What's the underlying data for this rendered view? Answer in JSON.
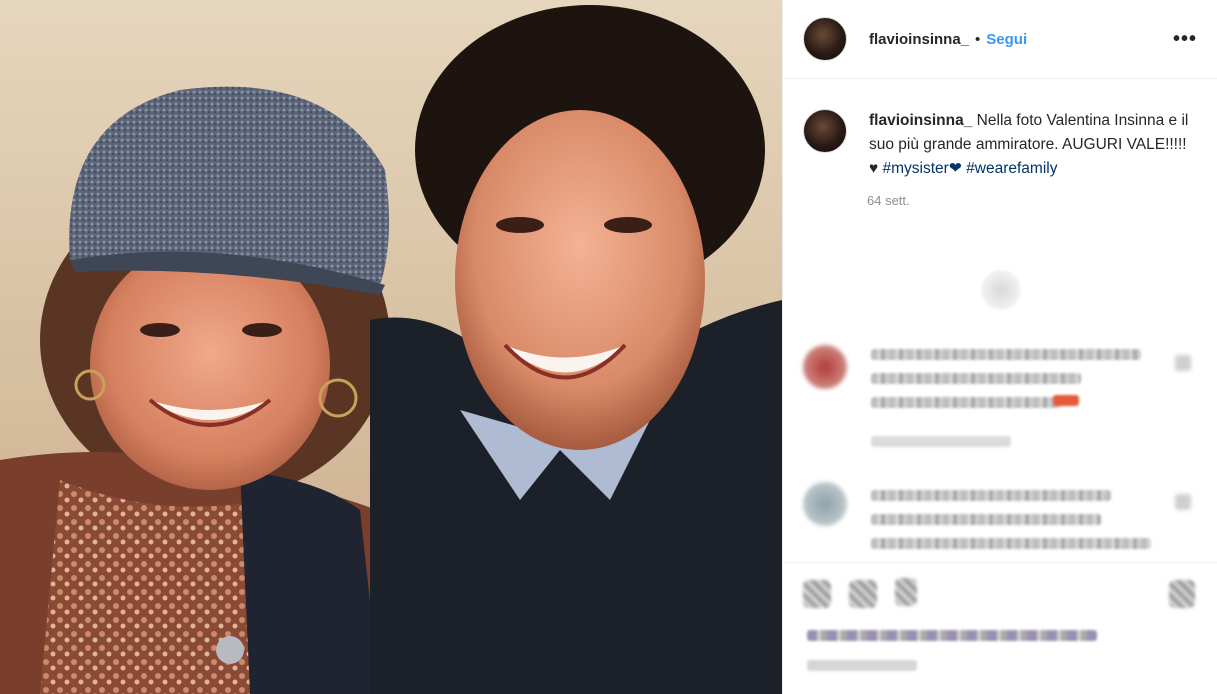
{
  "post": {
    "username": "flavioinsinna_",
    "separator": "•",
    "follow_label": "Segui",
    "more_label": "•••"
  },
  "caption": {
    "username": "flavioinsinna_",
    "text": " Nella foto Valentina Insinna e il suo più grande ammiratore. AUGURI VALE!!!!!♥ ",
    "hashtags": [
      "#mysister❤",
      "#wearefamily"
    ],
    "time": "64 sett."
  },
  "icons": {
    "more": "more-options-icon",
    "loading": "loading-spinner-icon",
    "like": "heart-icon",
    "comment": "comment-icon",
    "share": "share-icon",
    "save": "bookmark-icon"
  },
  "colors": {
    "follow": "#3897f0",
    "hashtag": "#003569",
    "muted": "#8e8e8e",
    "text": "#262626"
  }
}
